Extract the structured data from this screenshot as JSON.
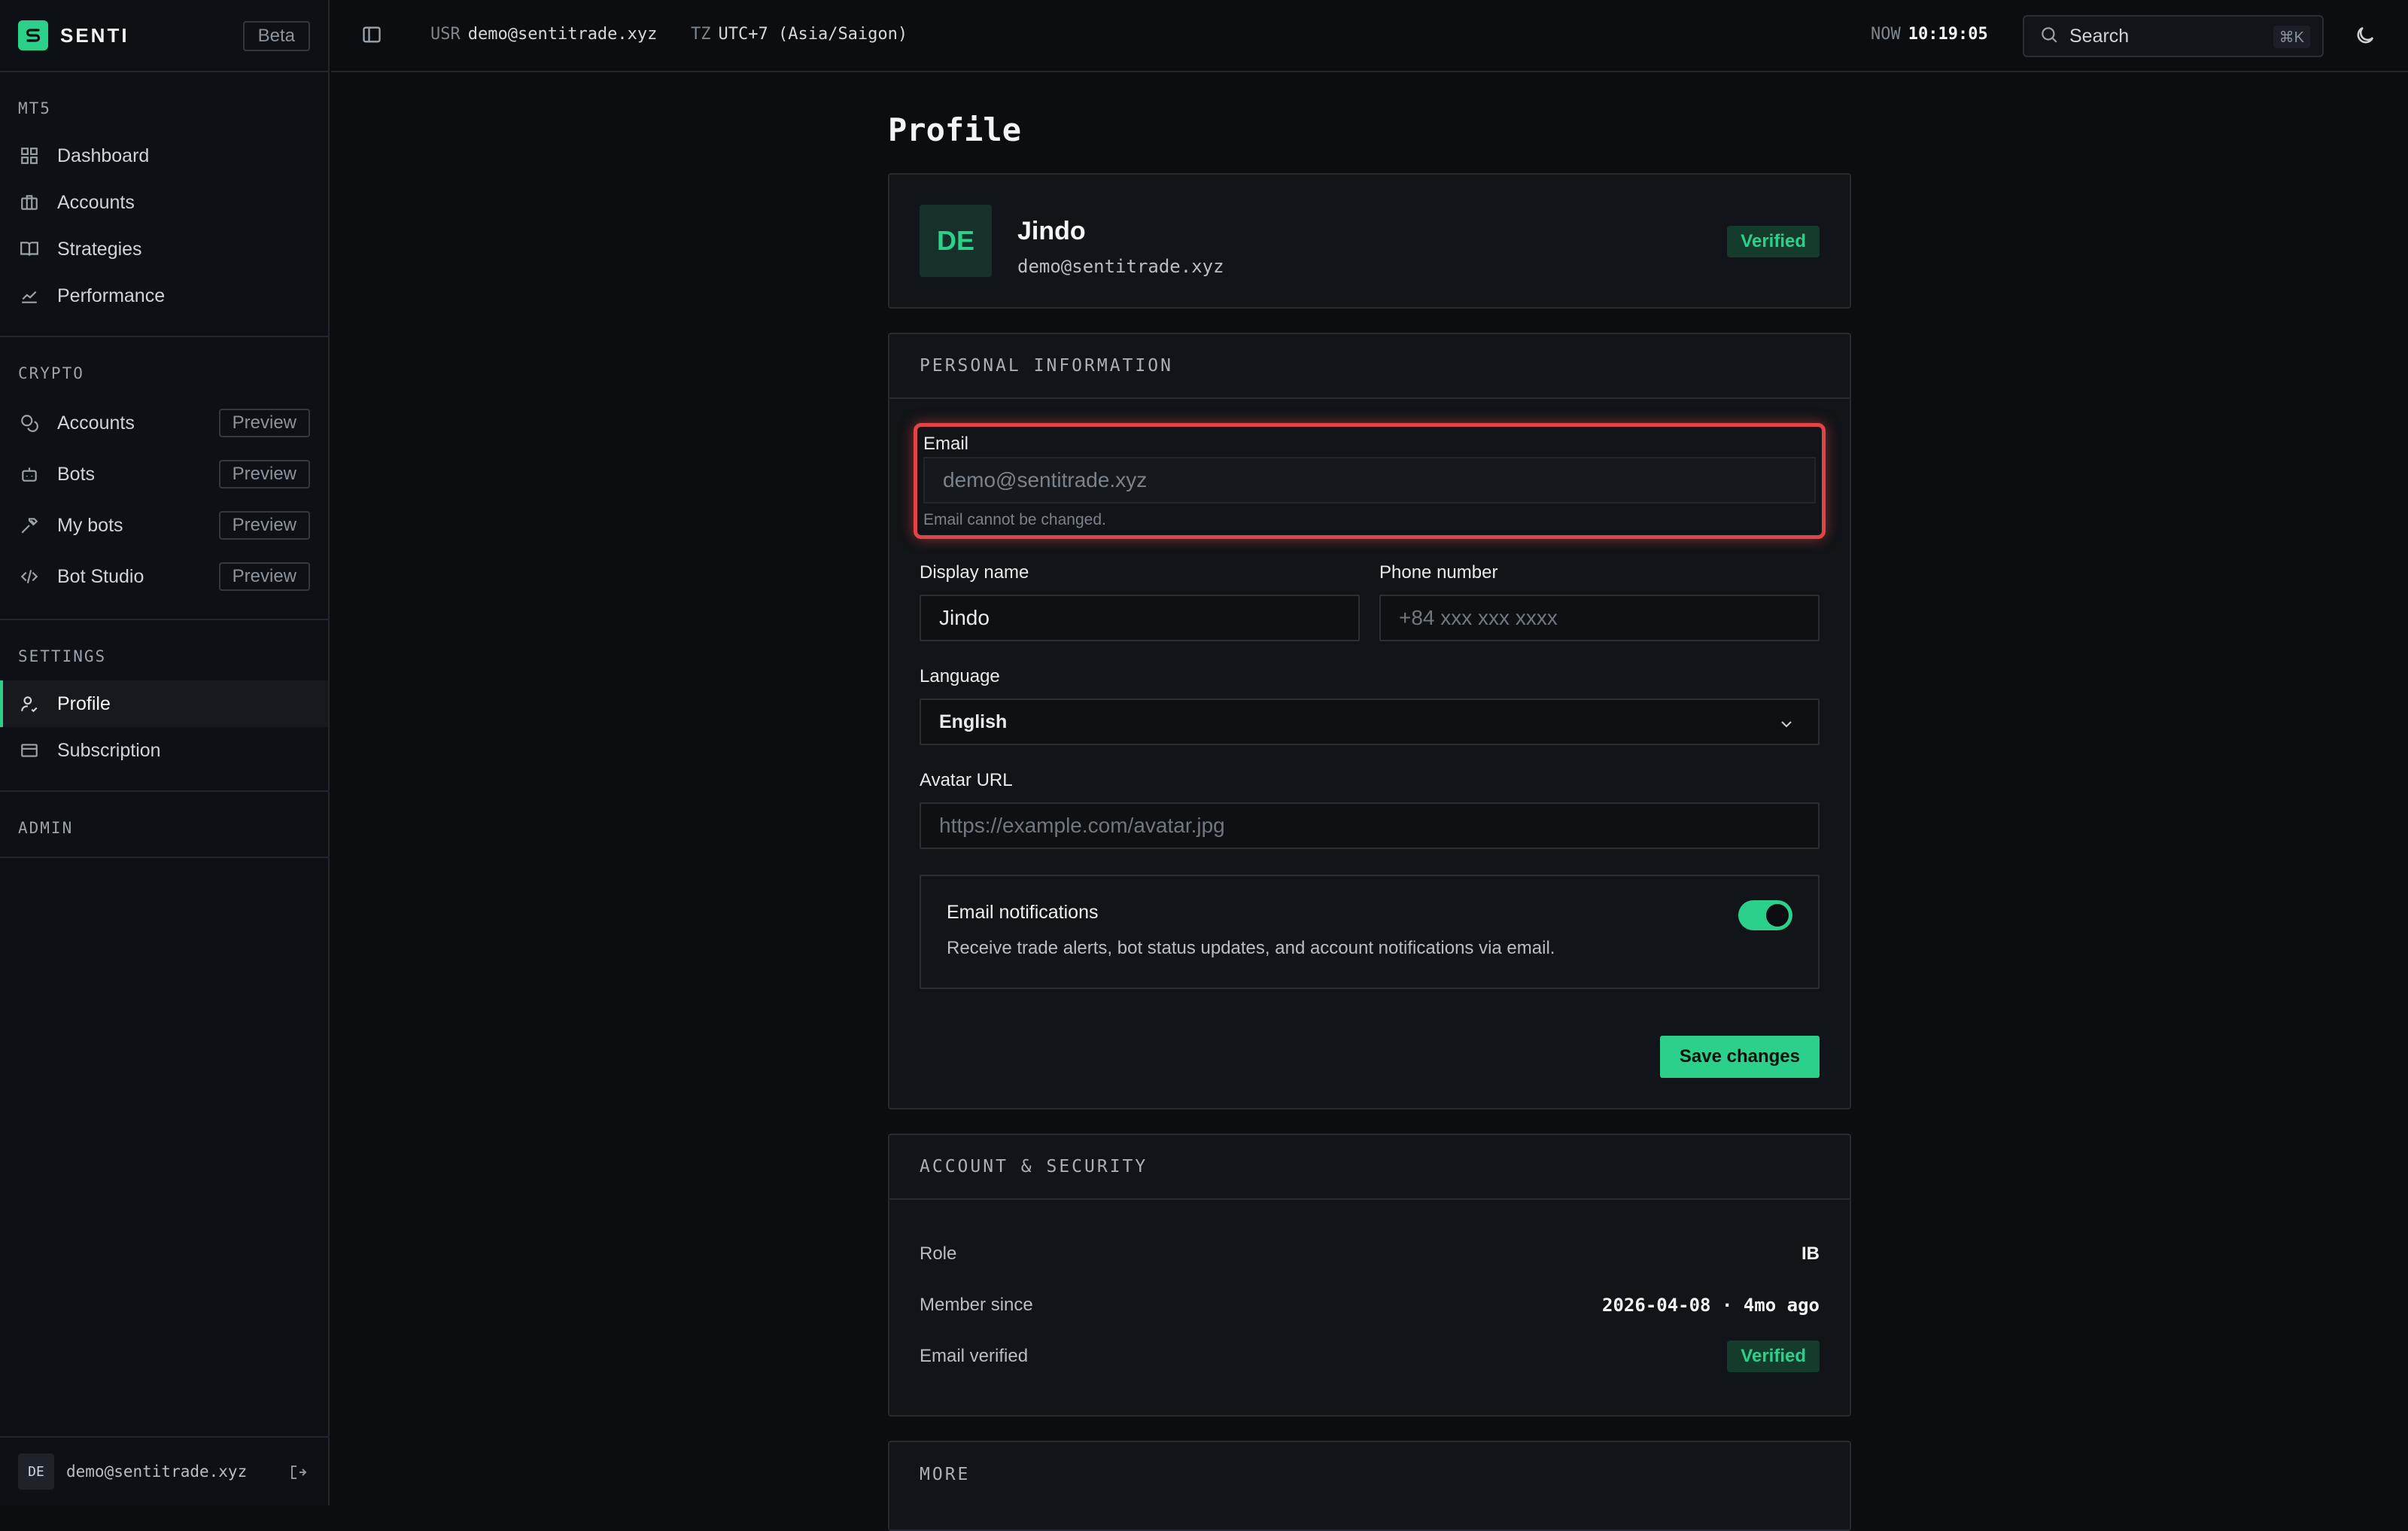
{
  "app": {
    "name": "SENTI",
    "beta_label": "Beta"
  },
  "sidebar": {
    "sections": [
      {
        "label": "MT5",
        "items": [
          {
            "label": "Dashboard",
            "icon": "grid-icon"
          },
          {
            "label": "Accounts",
            "icon": "briefcase-icon"
          },
          {
            "label": "Strategies",
            "icon": "book-icon"
          },
          {
            "label": "Performance",
            "icon": "line-chart-icon"
          }
        ]
      },
      {
        "label": "CRYPTO",
        "items": [
          {
            "label": "Accounts",
            "icon": "coins-icon",
            "badge": "Preview"
          },
          {
            "label": "Bots",
            "icon": "bot-icon",
            "badge": "Preview"
          },
          {
            "label": "My bots",
            "icon": "hammer-icon",
            "badge": "Preview"
          },
          {
            "label": "Bot Studio",
            "icon": "code-icon",
            "badge": "Preview"
          }
        ]
      },
      {
        "label": "SETTINGS",
        "items": [
          {
            "label": "Profile",
            "icon": "user-icon",
            "active": true
          },
          {
            "label": "Subscription",
            "icon": "credit-card-icon"
          }
        ]
      },
      {
        "label": "ADMIN",
        "items": []
      }
    ],
    "footer": {
      "avatar_initials": "DE",
      "email": "demo@sentitrade.xyz"
    }
  },
  "topbar": {
    "user_key": "USR",
    "user_value": "demo@sentitrade.xyz",
    "tz_key": "TZ",
    "tz_value": "UTC+7 (Asia/Saigon)",
    "now_key": "NOW",
    "now_value": "10:19:05",
    "search_label": "Search",
    "search_shortcut": "⌘K"
  },
  "page": {
    "title": "Profile"
  },
  "profile": {
    "initials": "DE",
    "name": "Jindo",
    "email": "demo@sentitrade.xyz",
    "status": "Verified"
  },
  "personal_info": {
    "header": "PERSONAL INFORMATION",
    "email_label": "Email",
    "email_value": "demo@sentitrade.xyz",
    "email_helper": "Email cannot be changed.",
    "display_name_label": "Display name",
    "display_name_value": "Jindo",
    "phone_label": "Phone number",
    "phone_placeholder": "+84 xxx xxx xxxx",
    "language_label": "Language",
    "language_value": "English",
    "avatar_label": "Avatar URL",
    "avatar_placeholder": "https://example.com/avatar.jpg",
    "notif_title": "Email notifications",
    "notif_desc": "Receive trade alerts, bot status updates, and account notifications via email.",
    "notif_enabled": true,
    "save_label": "Save changes"
  },
  "security": {
    "header": "ACCOUNT & SECURITY",
    "rows": [
      {
        "key": "Role",
        "value": "IB"
      },
      {
        "key": "Member since",
        "value": "2026-04-08 · 4mo ago"
      },
      {
        "key": "Email verified",
        "value": "Verified"
      }
    ]
  },
  "more": {
    "header": "MORE"
  },
  "colors": {
    "accent": "#2bd18b",
    "background": "#0b0d10",
    "highlight": "#e04545"
  }
}
